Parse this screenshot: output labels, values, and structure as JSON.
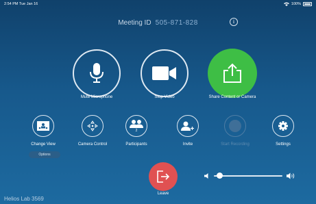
{
  "status": {
    "time": "2:54 PM",
    "date": "Tue Jan 16",
    "battery": "100%"
  },
  "meeting": {
    "label": "Meeting ID",
    "id": "505-871-828"
  },
  "controls": {
    "mute": "Mute Microphone",
    "stop_video": "Stop Video",
    "share": "Share Content or Camera",
    "change_view": "Change View",
    "options": "Options",
    "camera_control": "Camera Control",
    "participants": "Participants",
    "participants_count": "2",
    "invite": "Invite",
    "start_recording": "Start Recording",
    "settings": "Settings",
    "leave": "Leave"
  },
  "volume": {
    "level": 0.08
  },
  "room": {
    "name": "Helios Lab 3569"
  },
  "colors": {
    "share": "#3ebe45",
    "leave": "#e05152",
    "background": "#17598c"
  }
}
